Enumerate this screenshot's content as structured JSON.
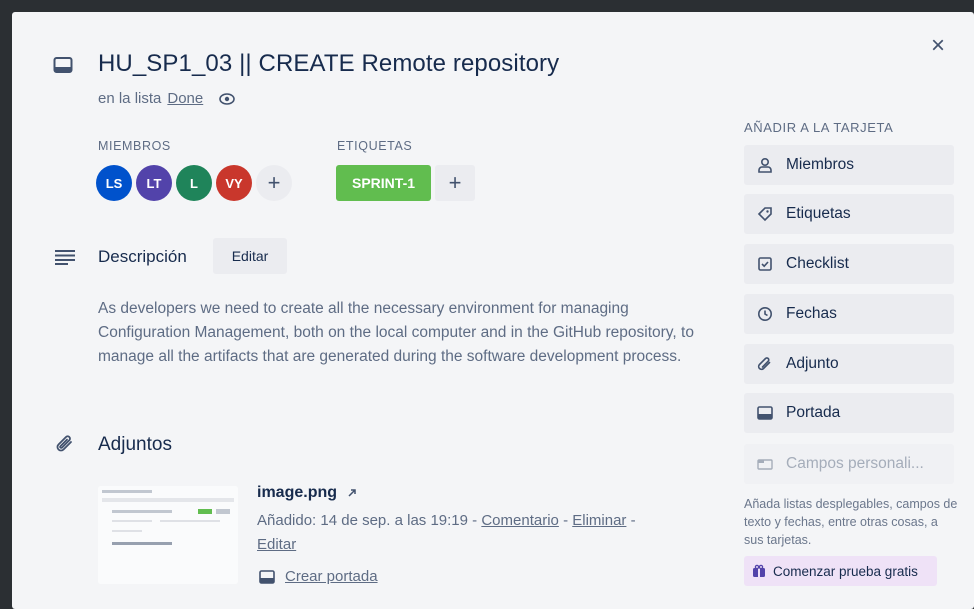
{
  "card": {
    "title": "HU_SP1_03 || CREATE Remote repository",
    "in_list_prefix": "en la lista",
    "list_name": "Done"
  },
  "members": {
    "label": "MIEMBROS",
    "avatars": [
      {
        "initials": "LS",
        "color": "#0052cc"
      },
      {
        "initials": "LT",
        "color": "#5243aa"
      },
      {
        "initials": "L",
        "color": "#1f845a"
      },
      {
        "initials": "VY",
        "color": "#c9372c"
      }
    ],
    "add": "+"
  },
  "labels": {
    "label": "ETIQUETAS",
    "items": [
      {
        "name": "SPRINT-1",
        "color": "#61bd4f"
      }
    ],
    "add": "+"
  },
  "description": {
    "title": "Descripción",
    "edit": "Editar",
    "text": "As developers we need to create all the necessary environment for managing Configuration Management, both on the local computer and in the GitHub repository, to manage all the artifacts that are generated during the software development process."
  },
  "attachments": {
    "title": "Adjuntos",
    "items": [
      {
        "name": "image.png",
        "added": "Añadido: 14 de sep. a las 19:19",
        "comment": "Comentario",
        "delete": "Eliminar",
        "edit": "Editar",
        "make_cover": "Crear portada"
      }
    ]
  },
  "sidebar": {
    "heading": "AÑADIR A LA TARJETA",
    "buttons": [
      {
        "label": "Miembros",
        "icon": "person-icon"
      },
      {
        "label": "Etiquetas",
        "icon": "tag-icon"
      },
      {
        "label": "Checklist",
        "icon": "checklist-icon"
      },
      {
        "label": "Fechas",
        "icon": "clock-icon"
      },
      {
        "label": "Adjunto",
        "icon": "paperclip-icon"
      },
      {
        "label": "Portada",
        "icon": "cover-icon"
      },
      {
        "label": "Campos personali...",
        "icon": "custom-fields-icon"
      }
    ],
    "note": "Añada listas desplegables, campos de texto y fechas, entre otras cosas, a sus tarjetas.",
    "trial": "Comenzar prueba gratis"
  },
  "close": "×",
  "colors": {
    "accent_green": "#61bd4f",
    "trial_bg": "#efe2f7"
  }
}
